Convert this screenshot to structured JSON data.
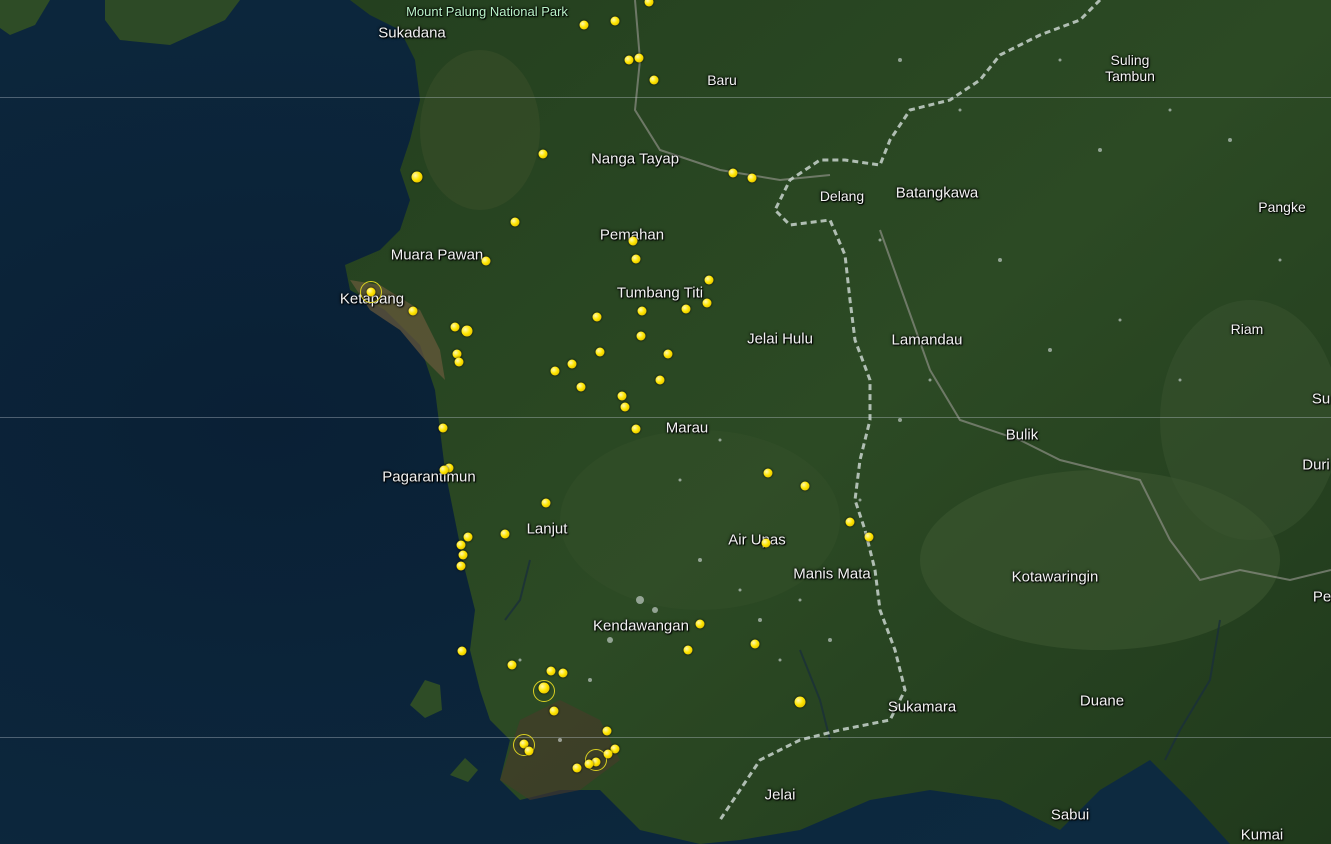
{
  "map": {
    "park_label": "Mount Palung National Park",
    "places": [
      {
        "key": "sukadana",
        "name": "Sukadana"
      },
      {
        "key": "baru",
        "name": "Baru"
      },
      {
        "key": "suling_tambun",
        "name": "Suling Tambun"
      },
      {
        "key": "nanga_tayap",
        "name": "Nanga Tayap"
      },
      {
        "key": "delang",
        "name": "Delang"
      },
      {
        "key": "batangkawa",
        "name": "Batangkawa"
      },
      {
        "key": "pangke",
        "name": "Pangke"
      },
      {
        "key": "pemahan",
        "name": "Pemahan"
      },
      {
        "key": "muara_pawan",
        "name": "Muara Pawan"
      },
      {
        "key": "ketapang",
        "name": "Ketapang"
      },
      {
        "key": "tumbang_titi",
        "name": "Tumbang Titi"
      },
      {
        "key": "riam",
        "name": "Riam"
      },
      {
        "key": "jelai_hulu",
        "name": "Jelai Hulu"
      },
      {
        "key": "lamandau",
        "name": "Lamandau"
      },
      {
        "key": "marau",
        "name": "Marau"
      },
      {
        "key": "bulik",
        "name": "Bulik"
      },
      {
        "key": "su",
        "name": "Su"
      },
      {
        "key": "duri",
        "name": "Duri"
      },
      {
        "key": "pagarantimun",
        "name": "Pagarantimun"
      },
      {
        "key": "lanjut",
        "name": "Lanjut"
      },
      {
        "key": "air_upas",
        "name": "Air Upas"
      },
      {
        "key": "manis_mata",
        "name": "Manis Mata"
      },
      {
        "key": "kotawaringin",
        "name": "Kotawaringin"
      },
      {
        "key": "pe",
        "name": "Pe"
      },
      {
        "key": "kendawangan",
        "name": "Kendawangan"
      },
      {
        "key": "sukamara",
        "name": "Sukamara"
      },
      {
        "key": "duane",
        "name": "Duane"
      },
      {
        "key": "jelai",
        "name": "Jelai"
      },
      {
        "key": "sabui",
        "name": "Sabui"
      },
      {
        "key": "kumai",
        "name": "Kumai"
      }
    ]
  },
  "colors": {
    "ocean": "#0b2236",
    "forest": "#1f3a1c",
    "hotspot": "#ffe600",
    "border": "#c8d4cc"
  }
}
